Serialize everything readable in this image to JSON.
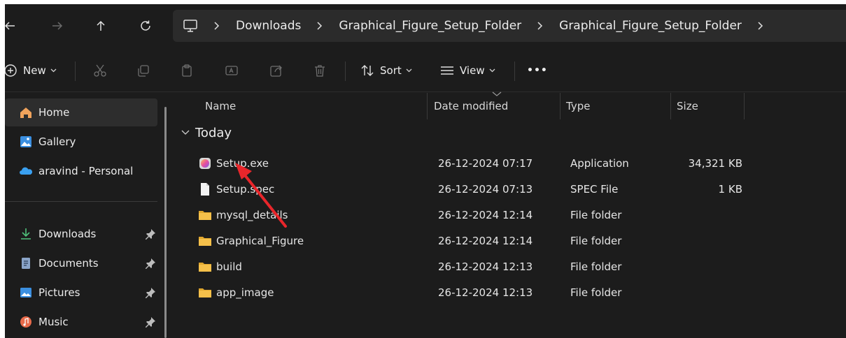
{
  "address": {
    "crumbs": [
      "Downloads",
      "Graphical_Figure_Setup_Folder",
      "Graphical_Figure_Setup_Folder"
    ]
  },
  "toolbar": {
    "new_label": "New",
    "sort_label": "Sort",
    "view_label": "View",
    "more_label": "•••"
  },
  "sidebar": {
    "items": [
      {
        "label": "Home",
        "icon": "home-icon"
      },
      {
        "label": "Gallery",
        "icon": "gallery-icon"
      },
      {
        "label": "aravind - Personal",
        "icon": "onedrive-cloud-icon"
      },
      {
        "label": "Downloads",
        "icon": "download-icon",
        "pinned": true
      },
      {
        "label": "Documents",
        "icon": "document-icon",
        "pinned": true
      },
      {
        "label": "Pictures",
        "icon": "pictures-icon",
        "pinned": true
      },
      {
        "label": "Music",
        "icon": "music-icon",
        "pinned": true
      }
    ]
  },
  "columns": {
    "name": "Name",
    "date": "Date modified",
    "type": "Type",
    "size": "Size"
  },
  "group": {
    "label": "Today"
  },
  "files": [
    {
      "name": "Setup.exe",
      "date": "26-12-2024 07:17",
      "type": "Application",
      "size": "34,321 KB",
      "icon": "app-icon"
    },
    {
      "name": "Setup.spec",
      "date": "26-12-2024 07:13",
      "type": "SPEC File",
      "size": "1 KB",
      "icon": "file-icon"
    },
    {
      "name": "mysql_details",
      "date": "26-12-2024 12:14",
      "type": "File folder",
      "size": "",
      "icon": "folder-icon"
    },
    {
      "name": "Graphical_Figure",
      "date": "26-12-2024 12:14",
      "type": "File folder",
      "size": "",
      "icon": "folder-icon"
    },
    {
      "name": "build",
      "date": "26-12-2024 12:13",
      "type": "File folder",
      "size": "",
      "icon": "folder-icon"
    },
    {
      "name": "app_image",
      "date": "26-12-2024 12:13",
      "type": "File folder",
      "size": "",
      "icon": "folder-icon"
    }
  ],
  "colors": {
    "background": "#1c1c1c",
    "folder": "#f5c04a",
    "arrow": "#e8262b",
    "onedrive": "#3aa0f0"
  }
}
